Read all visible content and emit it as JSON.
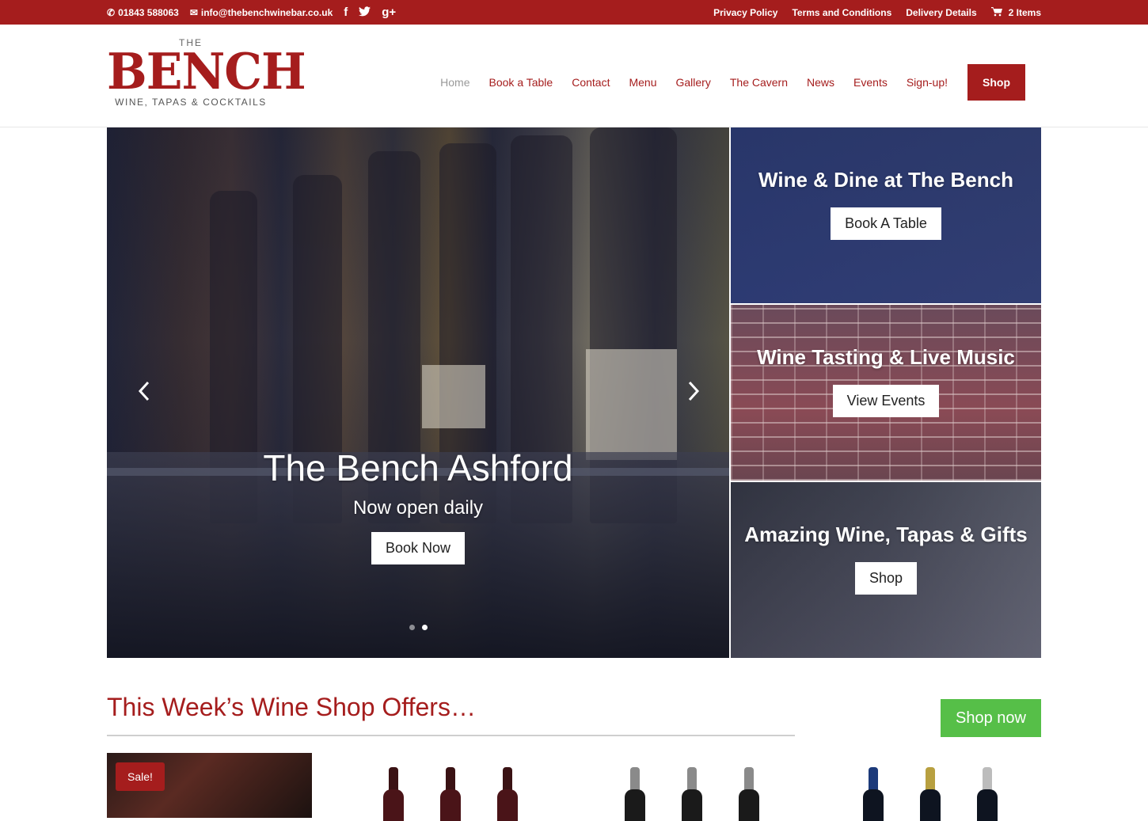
{
  "topbar": {
    "phone": "01843 588063",
    "email": "info@thebenchwinebar.co.uk",
    "social": [
      "f",
      "t",
      "g+"
    ],
    "links": [
      "Privacy Policy",
      "Terms and Conditions",
      "Delivery Details"
    ],
    "cart": "2 Items"
  },
  "logo": {
    "the": "THE",
    "name": "BENCH",
    "tagline": "WINE, TAPAS & COCKTAILS"
  },
  "nav": {
    "items": [
      "Home",
      "Book a Table",
      "Contact",
      "Menu",
      "Gallery",
      "The Cavern",
      "News",
      "Events",
      "Sign-up!"
    ],
    "active": "Home",
    "shop": "Shop"
  },
  "hero": {
    "title": "The Bench Ashford",
    "subtitle": "Now open daily",
    "button": "Book Now",
    "prev_icon": "chevron-left-icon",
    "next_icon": "chevron-right-icon",
    "slide_count": 2,
    "active_slide": 2
  },
  "panels": [
    {
      "title": "Wine & Dine at The Bench",
      "button": "Book A Table"
    },
    {
      "title": "Wine Tasting & Live Music",
      "button": "View Events"
    },
    {
      "title": "Amazing Wine, Tapas & Gifts",
      "button": "Shop"
    }
  ],
  "offers": {
    "title": "This Week’s Wine Shop Offers…",
    "shop_now": "Shop now",
    "sale_badge": "Sale!"
  },
  "colors": {
    "brand_red": "#a51d1d",
    "shop_now_green": "#56bf48"
  }
}
